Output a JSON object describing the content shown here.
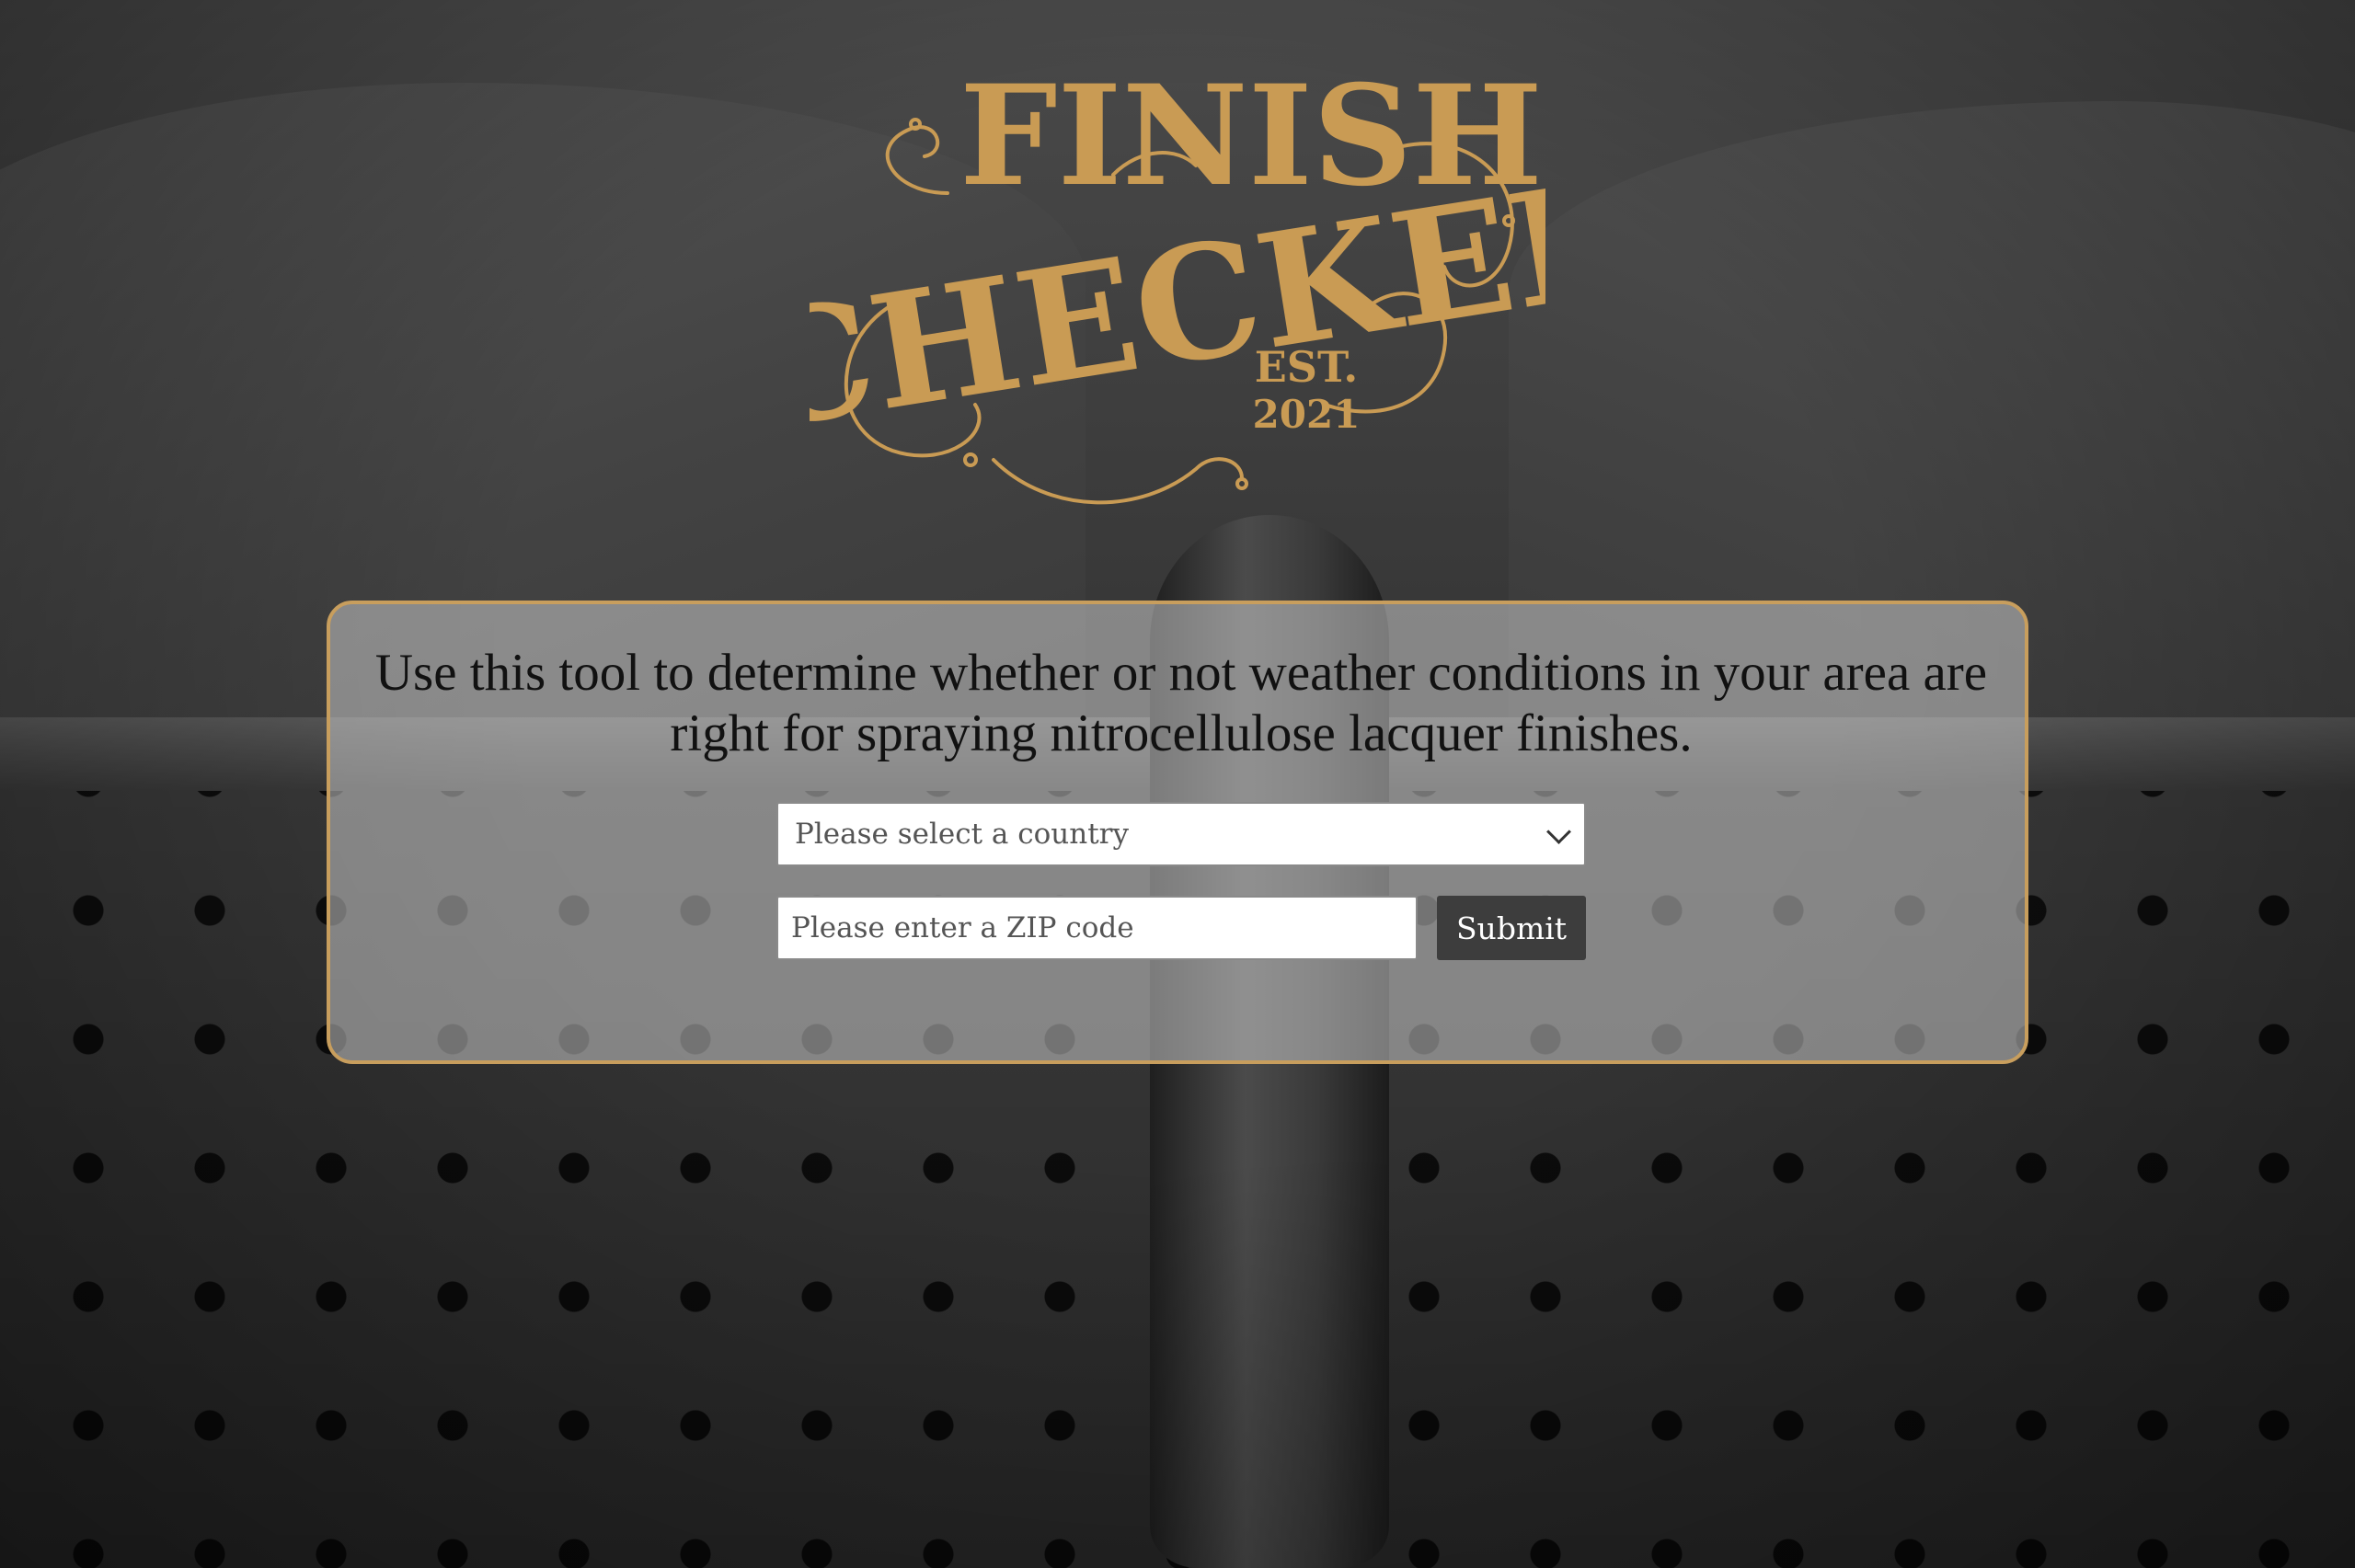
{
  "logo": {
    "line1": "FINISH",
    "line2": "CHECKER",
    "est": "EST.",
    "year": "2021",
    "color": "#c99b54"
  },
  "panel": {
    "intro": "Use this tool to determine whether or not weather conditions in your area are right for spraying nitrocellulose lacquer finishes.",
    "border_color": "#c89e5d"
  },
  "form": {
    "country_select": {
      "selected": "Please select a country"
    },
    "zip": {
      "placeholder": "Please enter a ZIP code",
      "value": ""
    },
    "submit_label": "Submit",
    "submit_color": "#3d3d3d"
  }
}
